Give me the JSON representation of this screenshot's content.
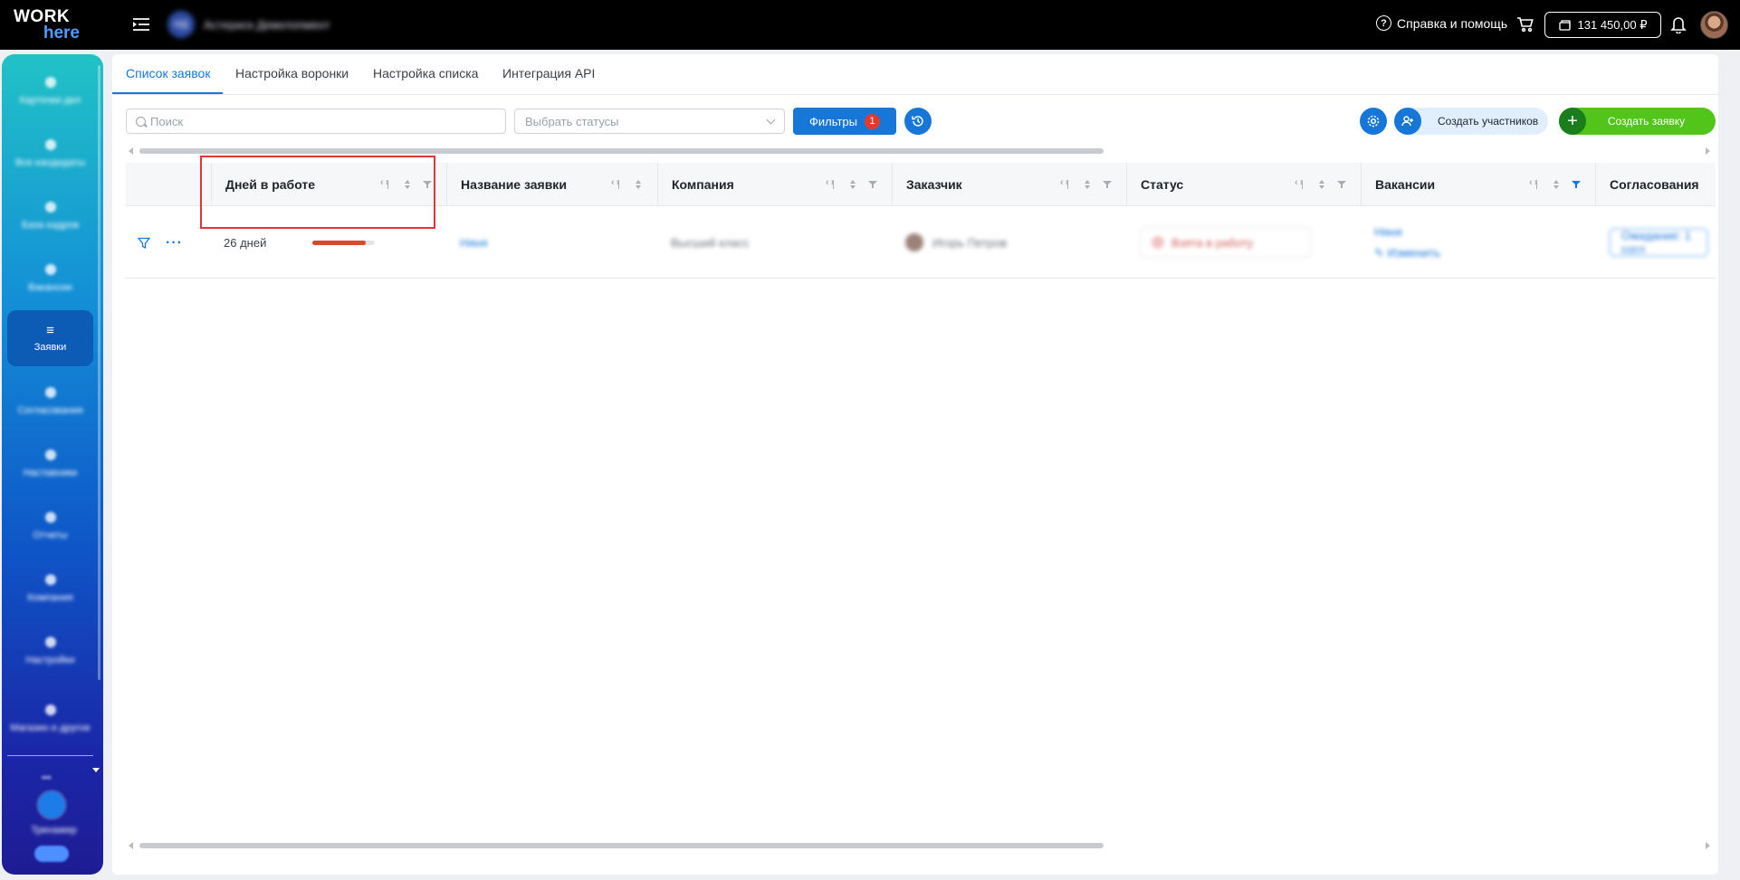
{
  "header": {
    "logo_line1": "WORK",
    "logo_line2": "here",
    "org_initials": "ИД",
    "org_name": "Астериск Девелопмент",
    "help_label": "Справка и помощь",
    "balance": "131 450,00 ₽"
  },
  "sidebar": {
    "items": [
      {
        "label": "Карточки дел",
        "icon": "rocket-icon"
      },
      {
        "label": "Все кандидаты",
        "icon": "people-icon"
      },
      {
        "label": "База кадров",
        "icon": "database-icon"
      },
      {
        "label": "Вакансии",
        "icon": "briefcase-icon"
      },
      {
        "label": "Заявки",
        "icon": "list-icon",
        "active": true
      },
      {
        "label": "Согласования",
        "icon": "check-icon"
      },
      {
        "label": "Наставники",
        "icon": "mentor-icon"
      },
      {
        "label": "Отчеты",
        "icon": "chart-icon"
      },
      {
        "label": "Компания",
        "icon": "building-icon"
      },
      {
        "label": "Настройки",
        "icon": "gear-icon"
      },
      {
        "label": "Магазин и другое",
        "icon": "shop-icon"
      }
    ],
    "more_label": "•••",
    "bottom_label": "Тренажер"
  },
  "tabs": [
    {
      "label": "Список заявок",
      "active": true
    },
    {
      "label": "Настройка воронки"
    },
    {
      "label": "Настройка списка"
    },
    {
      "label": "Интеграция API"
    }
  ],
  "toolbar": {
    "search_placeholder": "Поиск",
    "status_placeholder": "Выбрать статусы",
    "filters_label": "Фильтры",
    "filters_count": "1",
    "participants_label": "Создать участников",
    "create_label": "Создать заявку"
  },
  "table": {
    "columns": [
      "Дней в работе",
      "Название заявки",
      "Компания",
      "Заказчик",
      "Статус",
      "Вакансии",
      "Согласования"
    ],
    "rows": [
      {
        "days": "26 дней",
        "days_progress": 0.85,
        "name": "Няня",
        "company": "Высший класс",
        "customer": "Игорь Петров",
        "status": "Взята в работу",
        "vacancy": "Няня",
        "vacancy_edit": "Изменить",
        "approval": "Ожидание: 1 согл"
      }
    ]
  },
  "colors": {
    "accent": "#1677d9",
    "create": "#52c41a",
    "badge": "#e23b2e",
    "progress": "#d24e26",
    "highlight": "#e0353b"
  }
}
